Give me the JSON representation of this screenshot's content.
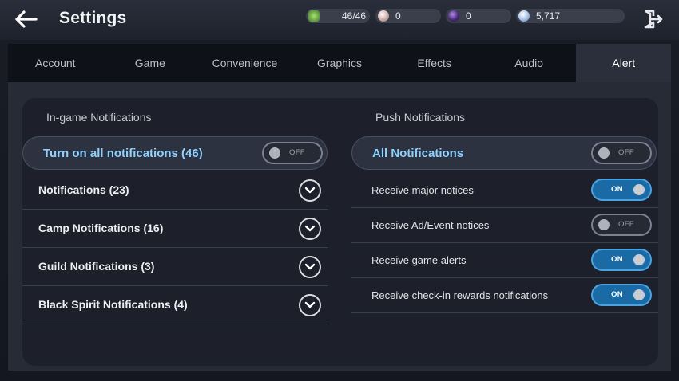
{
  "header": {
    "title": "Settings",
    "back_icon": "arrow-left-icon",
    "exit_icon": "exit-door-icon",
    "currencies": [
      {
        "icon": "energy-icon",
        "value": "46/46",
        "color": "#6fbf4a"
      },
      {
        "icon": "pearl-icon",
        "value": "0",
        "color": "#d9b8b8"
      },
      {
        "icon": "black-stone-icon",
        "value": "0",
        "color": "#5a3a8a"
      },
      {
        "icon": "silver-coin-icon",
        "value": "5,717",
        "color": "#8fb8e0"
      }
    ]
  },
  "tabs": [
    {
      "label": "Account",
      "active": false
    },
    {
      "label": "Game",
      "active": false
    },
    {
      "label": "Convenience",
      "active": false
    },
    {
      "label": "Graphics",
      "active": false
    },
    {
      "label": "Effects",
      "active": false
    },
    {
      "label": "Audio",
      "active": false
    },
    {
      "label": "Alert",
      "active": true
    }
  ],
  "in_game": {
    "section_title": "In-game Notifications",
    "master": {
      "label": "Turn on all notifications (46)",
      "state": "OFF"
    },
    "items": [
      {
        "label": "Notifications (23)"
      },
      {
        "label": "Camp Notifications (16)"
      },
      {
        "label": "Guild Notifications (3)"
      },
      {
        "label": "Black Spirit Notifications (4)"
      }
    ]
  },
  "push": {
    "section_title": "Push Notifications",
    "master": {
      "label": "All Notifications",
      "state": "OFF"
    },
    "items": [
      {
        "label": "Receive major notices",
        "state": "ON"
      },
      {
        "label": "Receive Ad/Event notices",
        "state": "OFF"
      },
      {
        "label": "Receive game alerts",
        "state": "ON"
      },
      {
        "label": "Receive check-in rewards notifications",
        "state": "ON"
      }
    ]
  }
}
